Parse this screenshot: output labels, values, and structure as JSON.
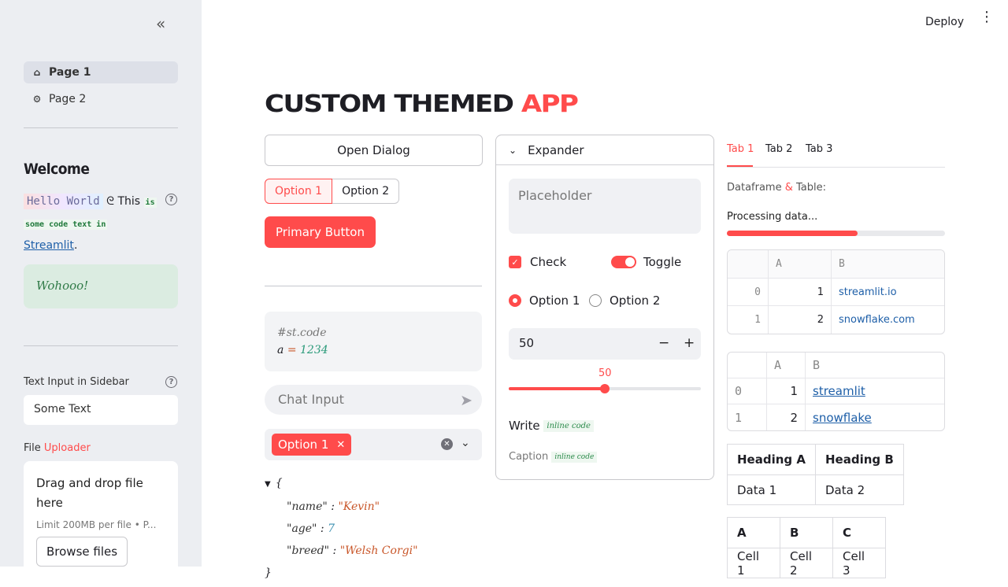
{
  "sidebar": {
    "collapse_icon": "double-chevron-left-icon",
    "nav": [
      {
        "label": "Page 1",
        "icon": "home-icon",
        "active": true
      },
      {
        "label": "Page 2",
        "icon": "gear-icon",
        "active": false
      }
    ],
    "welcome": "Welcome",
    "hello_world": "Hello World",
    "this": "This",
    "is": "is",
    "code_text": "some code text in",
    "streamlit_link": "Streamlit",
    "period": ".",
    "success": "Wohooo!",
    "text_input_label": "Text Input in Sidebar",
    "text_input_value": "Some Text",
    "file_label_a": "File",
    "file_label_b": "Uploader",
    "uploader_title": "Drag and drop file here",
    "uploader_limit": "Limit 200MB per file • P...",
    "browse_label": "Browse files"
  },
  "header": {
    "deploy": "Deploy"
  },
  "main": {
    "title_a": "CUSTOM THEMED",
    "title_b": "APP",
    "open_dialog": "Open Dialog",
    "seg_options": [
      "Option 1",
      "Option 2"
    ],
    "primary_button": "Primary Button",
    "code_comment": "#st.code",
    "code_var": "a",
    "code_eq": "=",
    "code_num": "1234",
    "chat_placeholder": "Chat Input",
    "multiselect_tag": "Option 1",
    "json": {
      "open": "{",
      "close": "}",
      "lines": [
        {
          "key": "\"name\"",
          "value": "\"Kevin\"",
          "type": "s"
        },
        {
          "key": "\"age\"",
          "value": "7",
          "type": "n"
        },
        {
          "key": "\"breed\"",
          "value": "\"Welsh Corgi\"",
          "type": "s"
        }
      ]
    }
  },
  "expander": {
    "label": "Expander",
    "textarea_placeholder": "Placeholder",
    "check_label": "Check",
    "toggle_label": "Toggle",
    "radio": [
      "Option 1",
      "Option 2"
    ],
    "number_value": "50",
    "minus": "−",
    "plus": "+",
    "slider_value": "50",
    "slider_fraction": 0.5,
    "write_label": "Write",
    "write_code": "inline code",
    "caption_label": "Caption",
    "caption_code": "inline code"
  },
  "tabs": {
    "items": [
      "Tab 1",
      "Tab 2",
      "Tab 3"
    ],
    "df_title_a": "Dataframe",
    "df_title_amp": "&",
    "df_title_b": "Table:",
    "progress_text": "Processing data...",
    "progress_fraction": 0.6,
    "df1": {
      "headers": [
        "",
        "A",
        "B"
      ],
      "rows": [
        [
          "0",
          "1",
          "streamlit.io"
        ],
        [
          "1",
          "2",
          "snowflake.com"
        ]
      ]
    },
    "df2": {
      "headers": [
        "",
        "A",
        "B"
      ],
      "rows": [
        [
          "0",
          "1",
          "streamlit"
        ],
        [
          "1",
          "2",
          "snowflake"
        ]
      ]
    },
    "table1": {
      "headers": [
        "Heading A",
        "Heading B"
      ],
      "rows": [
        [
          "Data 1",
          "Data 2"
        ]
      ]
    },
    "table2": {
      "headers": [
        "A",
        "B",
        "C"
      ],
      "rows": [
        [
          "Cell 1",
          "Cell 2",
          "Cell 3"
        ]
      ]
    }
  },
  "colors": {
    "accent": "#ff4b4b",
    "sidebar_bg": "#eceef2",
    "link": "#1e5fa8"
  }
}
